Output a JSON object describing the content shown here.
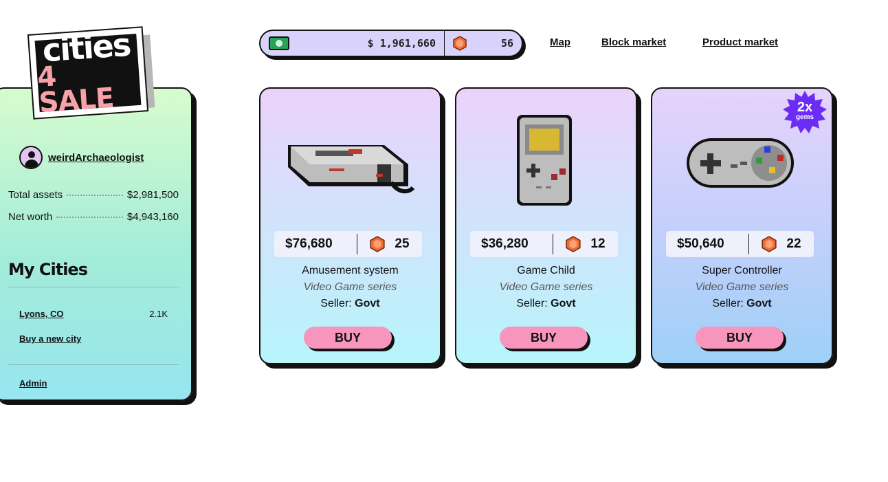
{
  "logo": {
    "line1": "cities",
    "line2": "4 SALE"
  },
  "user": {
    "name": "weirdArchaeologist"
  },
  "stats": [
    {
      "label": "Total assets",
      "value": "$2,981,500"
    },
    {
      "label": "Net worth",
      "value": "$4,943,160"
    }
  ],
  "my_cities": {
    "title": "My Cities",
    "cities": [
      {
        "name": "Lyons, CO",
        "count": "2.1K"
      }
    ],
    "buy_link": "Buy a new city",
    "admin_link": "Admin"
  },
  "wallet": {
    "cash": "$ 1,961,660",
    "gems": "56",
    "cash_icon": "money-bill-icon",
    "gem_icon": "gem-icon"
  },
  "nav": {
    "map": "Map",
    "block_market": "Block market",
    "product_market": "Product market"
  },
  "products": [
    {
      "name": "Amusement system",
      "series": "Video Game series",
      "seller_label": "Seller:",
      "seller": "Govt",
      "price": "$76,680",
      "gems": "25",
      "buy": "BUY",
      "art": "console-icon"
    },
    {
      "name": "Game Child",
      "series": "Video Game series",
      "seller_label": "Seller:",
      "seller": "Govt",
      "price": "$36,280",
      "gems": "12",
      "buy": "BUY",
      "art": "handheld-icon"
    },
    {
      "name": "Super Controller",
      "series": "Video Game series",
      "seller_label": "Seller:",
      "seller": "Govt",
      "price": "$50,640",
      "gems": "22",
      "buy": "BUY",
      "art": "controller-icon"
    }
  ],
  "badge": {
    "big": "2x",
    "small": "gems"
  },
  "colors": {
    "buy_button": "#f795bc",
    "wallet": "#d9d3fb",
    "gem": "#f26b2e"
  }
}
